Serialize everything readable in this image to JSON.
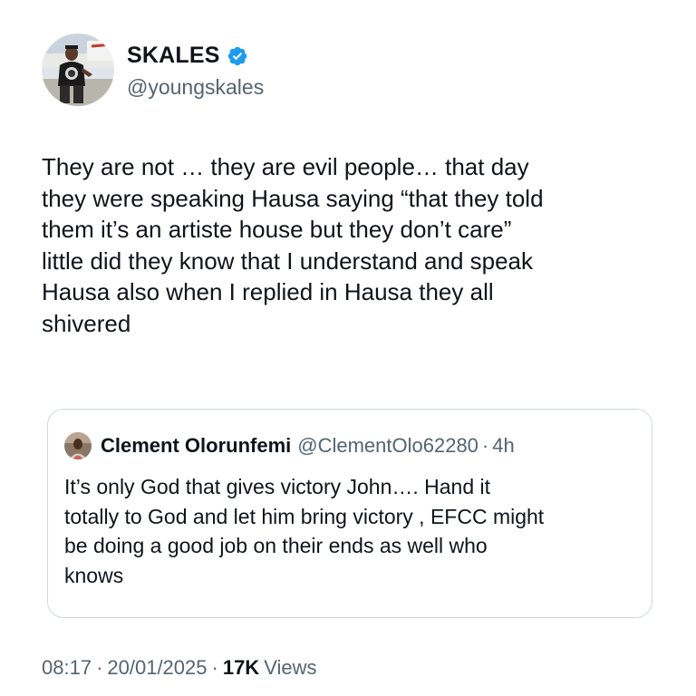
{
  "author": {
    "display_name": "SKALES",
    "handle": "@youngskales",
    "verified_icon": "verified-badge-icon",
    "avatar_icon": "user-avatar"
  },
  "tweet": {
    "text": "They are not … they are evil people… that day\nthey were speaking Hausa saying “that they told\nthem it’s an artiste house but they don’t care”\nlittle did they know that I understand and speak\nHausa also when I replied in Hausa they all\nshivered"
  },
  "quoted_tweet": {
    "display_name": "Clement Olorunfemi",
    "handle": "@ClementOlo62280",
    "separator": "·",
    "time": "4h",
    "text": "It’s only God that gives victory John…. Hand it\ntotally to God and let him bring victory , EFCC might\nbe doing a good job on their ends as well who\nknows"
  },
  "meta": {
    "time": "08:17",
    "separator": "·",
    "date": "20/01/2025",
    "views_count": "17K",
    "views_label": "Views"
  },
  "colors": {
    "text_primary": "#0f1419",
    "text_secondary": "#536471",
    "verified_blue": "#1d9bf0",
    "border": "#cfd9de"
  }
}
